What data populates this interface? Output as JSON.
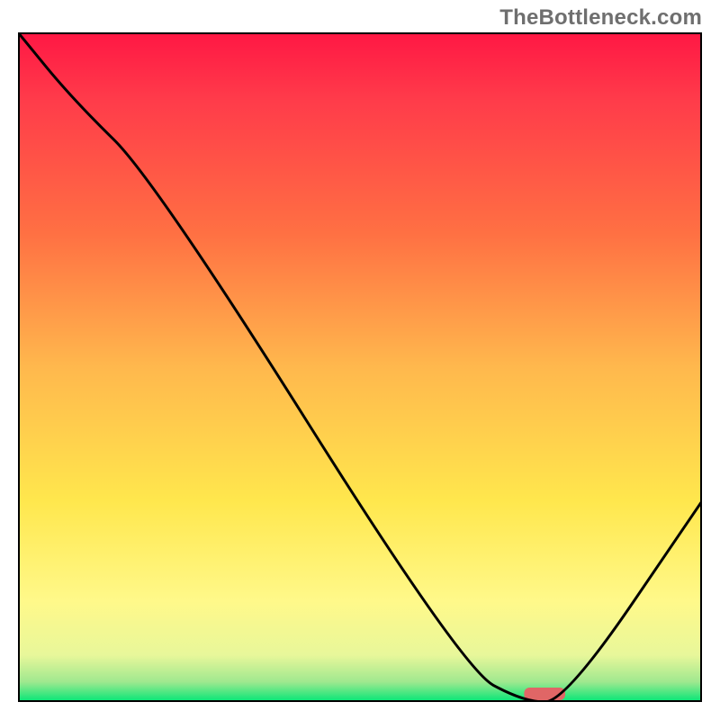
{
  "watermark": "TheBottleneck.com",
  "chart_data": {
    "type": "line",
    "title": "",
    "xlabel": "",
    "ylabel": "",
    "xlim": [
      0,
      100
    ],
    "ylim": [
      0,
      100
    ],
    "grid": false,
    "legend": false,
    "series": [
      {
        "name": "bottleneck-curve",
        "x": [
          0,
          8,
          20,
          65,
          74,
          80,
          100
        ],
        "y": [
          100,
          90,
          78,
          5,
          0,
          0,
          30
        ]
      }
    ],
    "marker": {
      "name": "optimal-range",
      "x_center": 77,
      "width": 6,
      "y": 0,
      "color": "#e06666"
    },
    "background_gradient": {
      "stops": [
        {
          "offset": 0.0,
          "color": "#ff1744"
        },
        {
          "offset": 0.1,
          "color": "#ff3b4a"
        },
        {
          "offset": 0.3,
          "color": "#ff7043"
        },
        {
          "offset": 0.5,
          "color": "#ffb84d"
        },
        {
          "offset": 0.7,
          "color": "#ffe74d"
        },
        {
          "offset": 0.85,
          "color": "#fff98a"
        },
        {
          "offset": 0.93,
          "color": "#e8f79a"
        },
        {
          "offset": 0.97,
          "color": "#9fe88f"
        },
        {
          "offset": 1.0,
          "color": "#00e676"
        }
      ]
    }
  }
}
